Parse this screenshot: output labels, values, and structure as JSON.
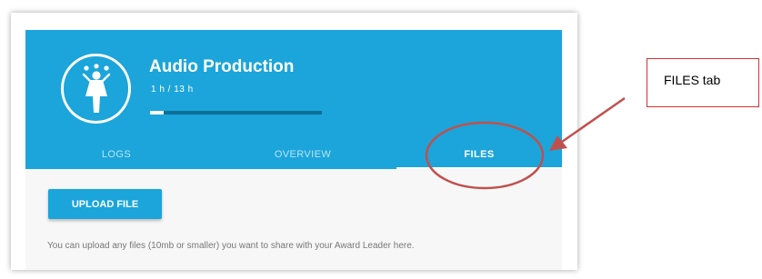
{
  "activity": {
    "title": "Audio Production",
    "hours": "1 h / 13 h",
    "progress_fraction": 0.077,
    "icon": "person-juggling-icon"
  },
  "tabs": [
    {
      "label": "LOGS",
      "active": false
    },
    {
      "label": "OVERVIEW",
      "active": false
    },
    {
      "label": "FILES",
      "active": true
    }
  ],
  "files": {
    "upload_label": "UPLOAD FILE",
    "helper_text": "You can upload any files (10mb or smaller) you want to share with your Award Leader here."
  },
  "annotation": {
    "label": "FILES tab"
  },
  "colors": {
    "brand": "#1ba5da",
    "annotation": "#c0504d"
  }
}
